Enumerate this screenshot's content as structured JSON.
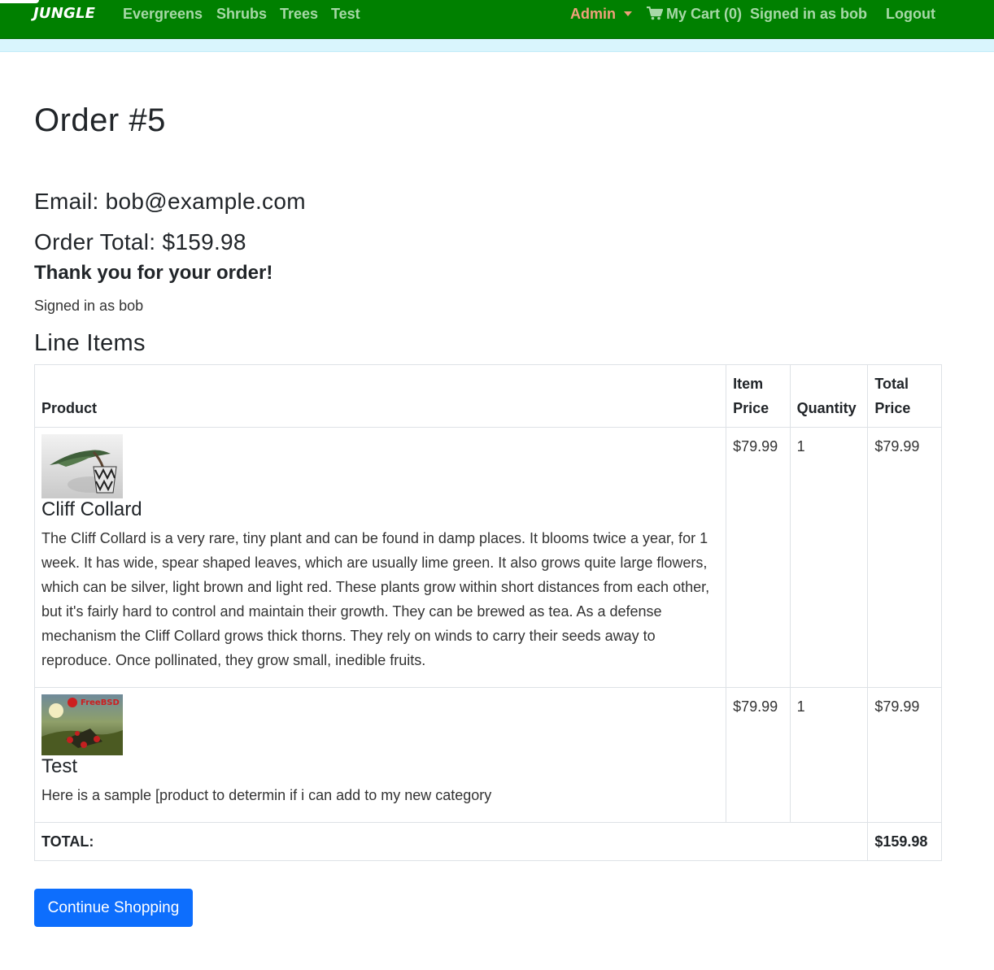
{
  "navbar": {
    "brand": "JUNGLE",
    "links": [
      "Evergreens",
      "Shrubs",
      "Trees",
      "Test"
    ],
    "admin_label": "Admin",
    "cart_label": "My Cart (0)",
    "signed_in": "Signed in as bob",
    "logout": "Logout",
    "colors": {
      "background": "#008000",
      "link": "#a7d8a7",
      "admin": "#f0a07a"
    }
  },
  "order": {
    "title": "Order #5",
    "email": "Email: bob@example.com",
    "total": "Order Total: $159.98",
    "thanks": "Thank you for your order!",
    "signed_in": "Signed in as bob"
  },
  "line_items": {
    "heading": "Line Items",
    "headers": {
      "product": "Product",
      "item_price": "Item Price",
      "quantity": "Quantity",
      "total_price": "Total Price"
    },
    "rows": [
      {
        "image_icon": "bonsai-plant-image",
        "name": "Cliff Collard",
        "description": "The Cliff Collard is a very rare, tiny plant and can be found in damp places. It blooms twice a year, for 1 week. It has wide, spear shaped leaves, which are usually lime green. It also grows quite large flowers, which can be silver, light brown and light red. These plants grow within short distances from each other, but it's fairly hard to control and maintain their growth. They can be brewed as tea. As a defense mechanism the Cliff Collard grows thick thorns. They rely on winds to carry their seeds away to reproduce. Once pollinated, they grow small, inedible fruits.",
        "item_price": "$79.99",
        "quantity": "1",
        "total_price": "$79.99"
      },
      {
        "image_icon": "freebsd-wallpaper-image",
        "image_text": "FreeBSD",
        "name": "Test",
        "description": "Here is a sample [product to determin if i can add to my new category",
        "item_price": "$79.99",
        "quantity": "1",
        "total_price": "$79.99"
      }
    ],
    "total_label": "TOTAL:",
    "total_value": "$159.98"
  },
  "continue_button": "Continue Shopping",
  "accent_color": "#0d6efd"
}
